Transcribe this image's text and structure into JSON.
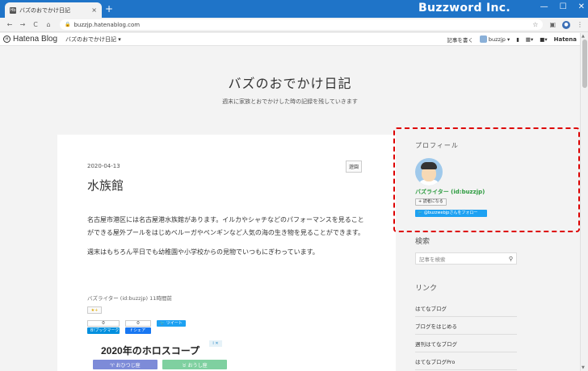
{
  "browser": {
    "tab_title": "バズのおでかけ日記",
    "tab_favicon": "はてな",
    "tab_close": "×",
    "new_tab": "+",
    "brand": "Buzzword Inc.",
    "url": "buzzjp.hatenablog.com",
    "back": "←",
    "forward": "→",
    "reload": "C",
    "home": "⌂"
  },
  "hatena_bar": {
    "logo": "Hatena Blog",
    "blog_menu": "バズのおでかけ日記 ▾",
    "write": "記事を書く",
    "user": "buzzjp ▾",
    "hatena": "Hatena"
  },
  "blog": {
    "title": "バズのおでかけ日記",
    "description": "週末に家族とおでかけした時の記録を残していきます"
  },
  "article": {
    "date": "2020-04-13",
    "category": "遊園",
    "title": "水族館",
    "paragraphs": [
      "名古屋市港区には名古屋港水族館があります。イルカやシャチなどのパフォーマンスを見ることができる屋外プールをはじめベルーガやペンギンなど人気の海の生き物を見ることができます。",
      "週末はもちろん平日でも幼稚園や小学校からの見物でいつもにぎわっています。"
    ],
    "author_line": "バズライター (id:buzzjp) 11時間前",
    "star": "★+",
    "share": {
      "hatebu_count": "0",
      "hatebu_label": "B!ブックマーク",
      "fb_count": "0",
      "fb_label": "f シェア",
      "tweet_label": "ツイート"
    },
    "ad": {
      "title": "2020年のホロスコープ",
      "badge": "i ✕",
      "chip1": "♈  おひつじ座",
      "chip2": "♉  おうし座"
    }
  },
  "sidebar": {
    "profile_heading": "プロフィール",
    "profile_name": "バズライター (id:buzzjp)",
    "reader_button": "+ 読者になる",
    "follow_button": "@buzzwebjpさんをフォロー",
    "search_heading": "検索",
    "search_placeholder": "記事を検索",
    "links_heading": "リンク",
    "links": [
      "はてなブログ",
      "ブログをはじめる",
      "週刊はてなブログ",
      "はてなブログPro"
    ]
  }
}
